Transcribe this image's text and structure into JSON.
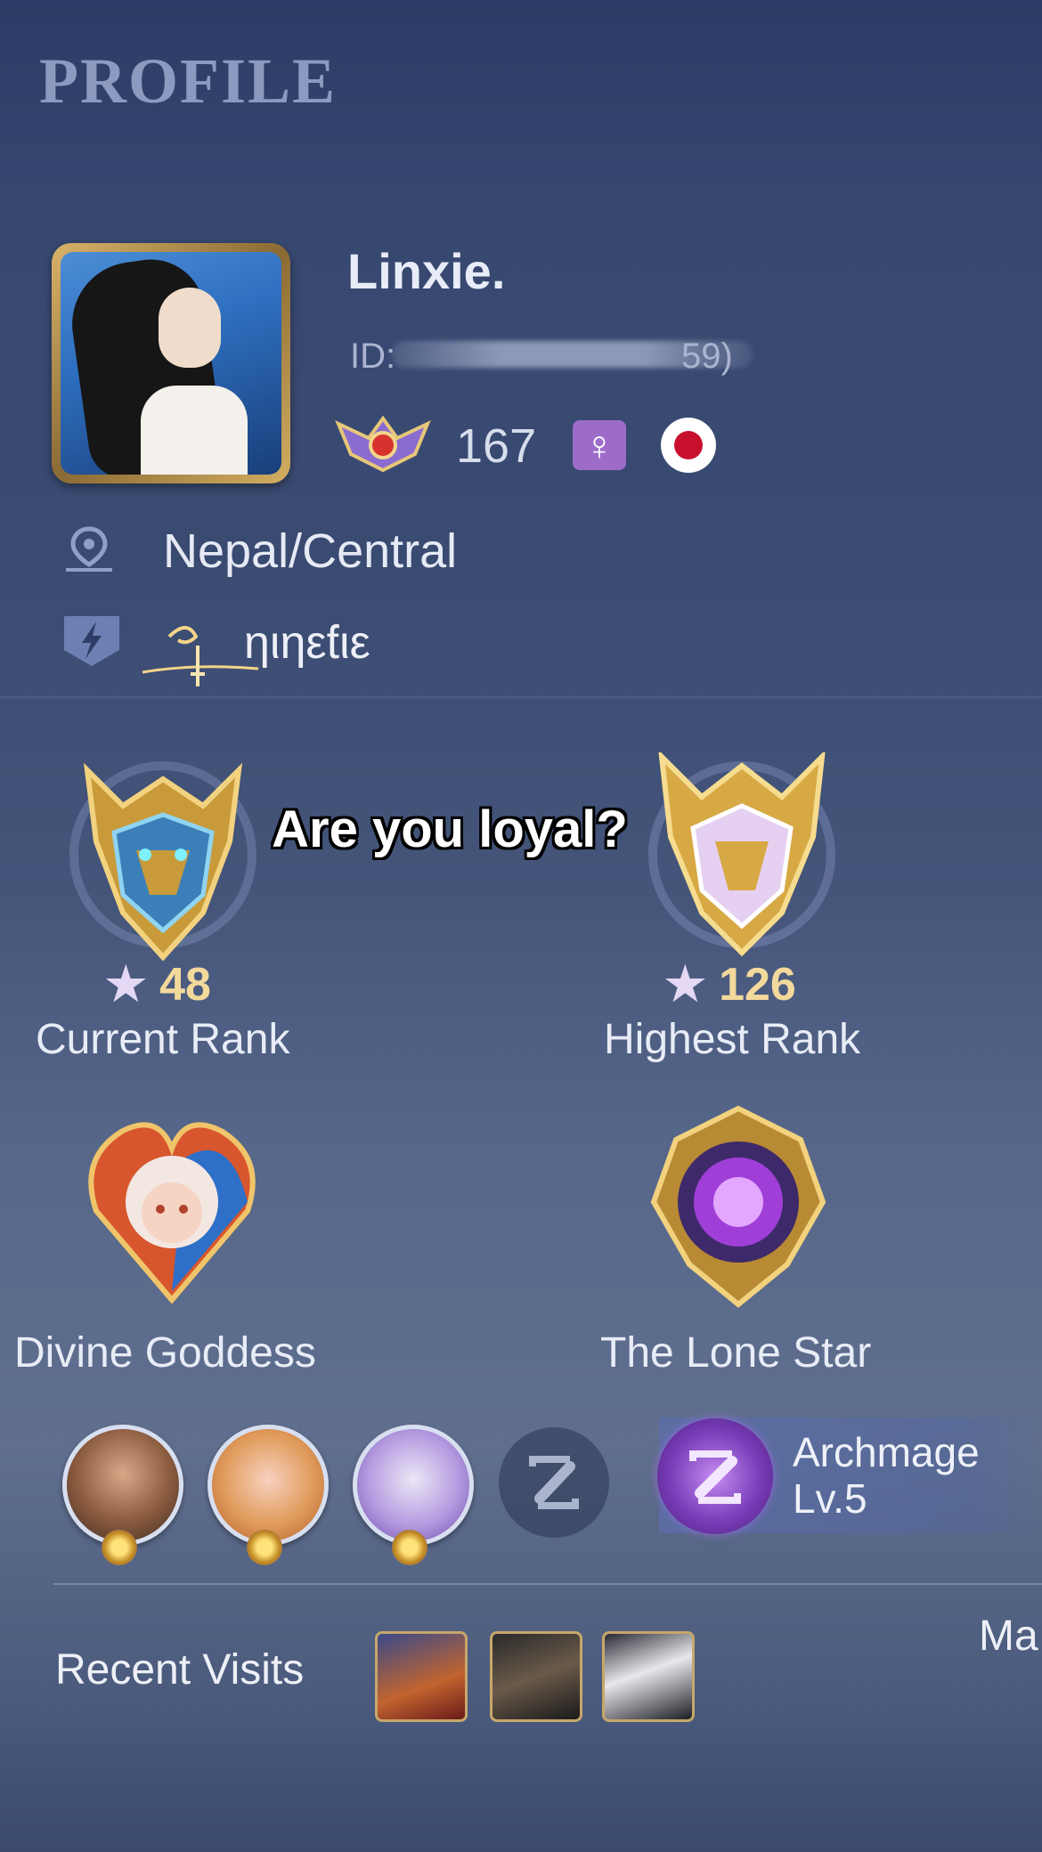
{
  "page": {
    "title": "PROFILE"
  },
  "profile": {
    "name": "Linxie.",
    "id_prefix": "ID:",
    "id_suffix": "59)",
    "level": "167",
    "gender_symbol": "♀",
    "location": "Nepal/Central",
    "squad": "ηιηεƭιε"
  },
  "overlay": {
    "caption": "Are you loyal?"
  },
  "ranks": {
    "current": {
      "stars": "48",
      "label": "Current Rank"
    },
    "highest": {
      "stars": "126",
      "label": "Highest Rank"
    }
  },
  "achievements": [
    {
      "label": "Divine Goddess"
    },
    {
      "label": "The Lone Star"
    }
  ],
  "heroes": {
    "archmage_title": "Archmage",
    "archmage_level": "Lv.5"
  },
  "recent_visits": {
    "label": "Recent Visits"
  },
  "edge_text": "Ma",
  "colors": {
    "title": "#8d9ac0",
    "gender_badge": "#9c6cc8",
    "flag_red": "#c8102e",
    "star_gold": "#f3d99b",
    "frame_gold": "#d9b36a"
  }
}
